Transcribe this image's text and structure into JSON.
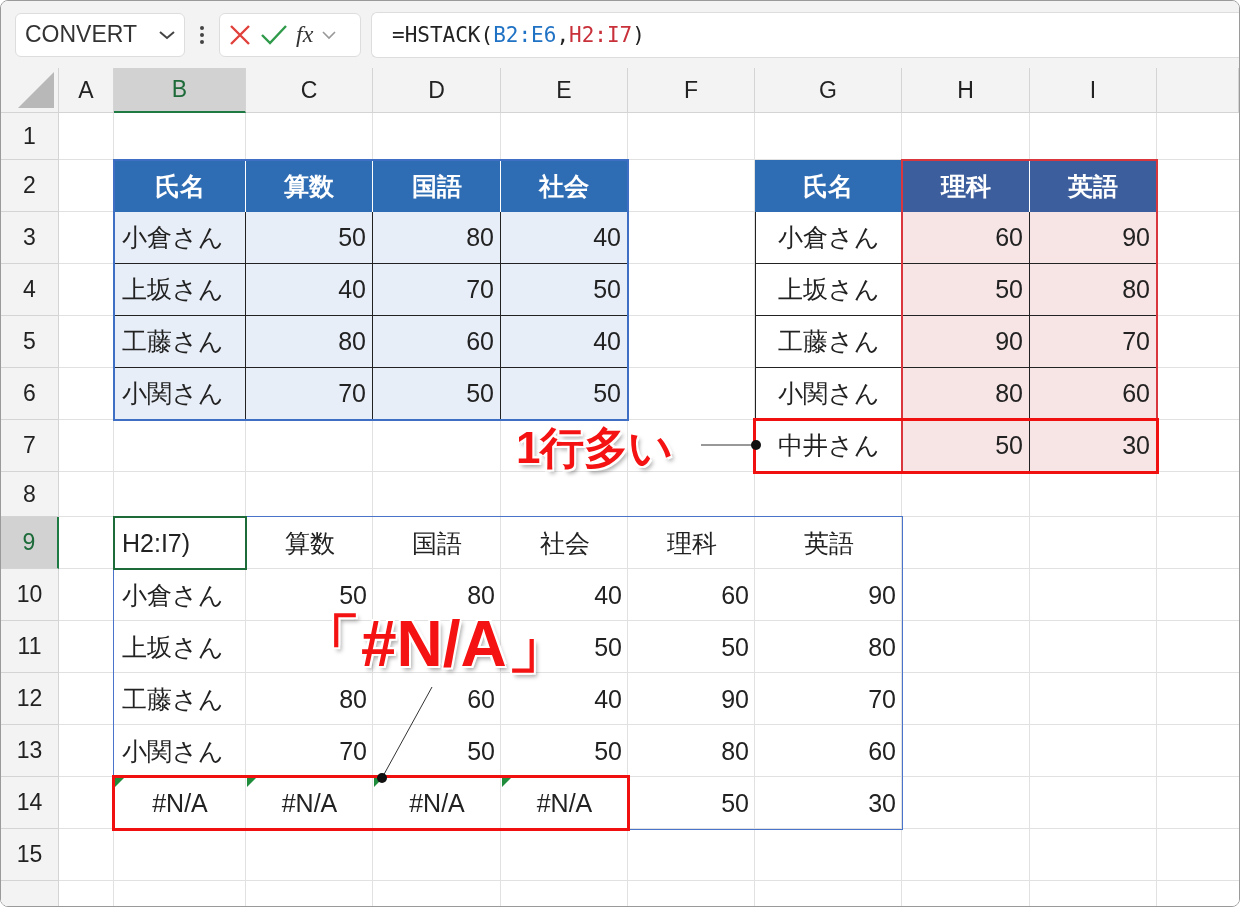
{
  "formula_bar": {
    "name_box": "CONVERT",
    "fx": "fx",
    "formula": [
      {
        "text": "=HSTACK(",
        "color": "#222222"
      },
      {
        "text": "B2:E6",
        "color": "#1f72c4"
      },
      {
        "text": ",",
        "color": "#222222"
      },
      {
        "text": "H2:I7",
        "color": "#c8303a"
      },
      {
        "text": ")",
        "color": "#222222"
      }
    ]
  },
  "columns": [
    {
      "label": "A",
      "selected": false
    },
    {
      "label": "B",
      "selected": true
    },
    {
      "label": "C",
      "selected": false
    },
    {
      "label": "D",
      "selected": false
    },
    {
      "label": "E",
      "selected": false
    },
    {
      "label": "F",
      "selected": false
    },
    {
      "label": "G",
      "selected": false
    },
    {
      "label": "H",
      "selected": false
    },
    {
      "label": "I",
      "selected": false
    }
  ],
  "row_headers": [
    {
      "label": "1",
      "selected": false
    },
    {
      "label": "2",
      "selected": false
    },
    {
      "label": "3",
      "selected": false
    },
    {
      "label": "4",
      "selected": false
    },
    {
      "label": "5",
      "selected": false
    },
    {
      "label": "6",
      "selected": false
    },
    {
      "label": "7",
      "selected": false
    },
    {
      "label": "8",
      "selected": false
    },
    {
      "label": "9",
      "selected": true
    },
    {
      "label": "10",
      "selected": false
    },
    {
      "label": "11",
      "selected": false
    },
    {
      "label": "12",
      "selected": false
    },
    {
      "label": "13",
      "selected": false
    },
    {
      "label": "14",
      "selected": false
    },
    {
      "label": "15",
      "selected": false
    }
  ],
  "left_table": {
    "header": [
      "氏名",
      "算数",
      "国語",
      "社会"
    ],
    "rows": [
      {
        "name": "小倉さん",
        "values": [
          "50",
          "80",
          "40"
        ]
      },
      {
        "name": "上坂さん",
        "values": [
          "40",
          "70",
          "50"
        ]
      },
      {
        "name": "工藤さん",
        "values": [
          "80",
          "60",
          "40"
        ]
      },
      {
        "name": "小関さん",
        "values": [
          "70",
          "50",
          "50"
        ]
      }
    ]
  },
  "right_table": {
    "header": [
      "氏名",
      "理科",
      "英語"
    ],
    "rows": [
      {
        "name": "小倉さん",
        "values": [
          "60",
          "90"
        ]
      },
      {
        "name": "上坂さん",
        "values": [
          "50",
          "80"
        ]
      },
      {
        "name": "工藤さん",
        "values": [
          "90",
          "70"
        ]
      },
      {
        "name": "小関さん",
        "values": [
          "80",
          "60"
        ]
      },
      {
        "name": "中井さん",
        "values": [
          "50",
          "30"
        ]
      }
    ]
  },
  "result": {
    "header": [
      "H2:I7)",
      "算数",
      "国語",
      "社会",
      "理科",
      "英語"
    ],
    "rows": [
      [
        {
          "text": "小倉さん",
          "error": false
        },
        {
          "text": "50",
          "error": false
        },
        {
          "text": "80",
          "error": false
        },
        {
          "text": "40",
          "error": false
        },
        {
          "text": "60",
          "error": false
        },
        {
          "text": "90",
          "error": false
        }
      ],
      [
        {
          "text": "上坂さん",
          "error": false
        },
        null,
        null,
        {
          "text": "50",
          "error": false
        },
        {
          "text": "50",
          "error": false
        },
        {
          "text": "80",
          "error": false
        }
      ],
      [
        {
          "text": "工藤さん",
          "error": false
        },
        {
          "text": "80",
          "error": false
        },
        {
          "text": "60",
          "error": false
        },
        {
          "text": "40",
          "error": false
        },
        {
          "text": "90",
          "error": false
        },
        {
          "text": "70",
          "error": false
        }
      ],
      [
        {
          "text": "小関さん",
          "error": false
        },
        {
          "text": "70",
          "error": false
        },
        {
          "text": "50",
          "error": false
        },
        {
          "text": "50",
          "error": false
        },
        {
          "text": "80",
          "error": false
        },
        {
          "text": "60",
          "error": false
        }
      ],
      [
        {
          "text": "#N/A",
          "error": true
        },
        {
          "text": "#N/A",
          "error": true
        },
        {
          "text": "#N/A",
          "error": true
        },
        {
          "text": "#N/A",
          "error": true
        },
        {
          "text": "50",
          "error": false
        },
        {
          "text": "30",
          "error": false
        }
      ]
    ]
  },
  "callouts": [
    {
      "text": "1行多い"
    },
    {
      "text": "「#N/A」"
    }
  ]
}
